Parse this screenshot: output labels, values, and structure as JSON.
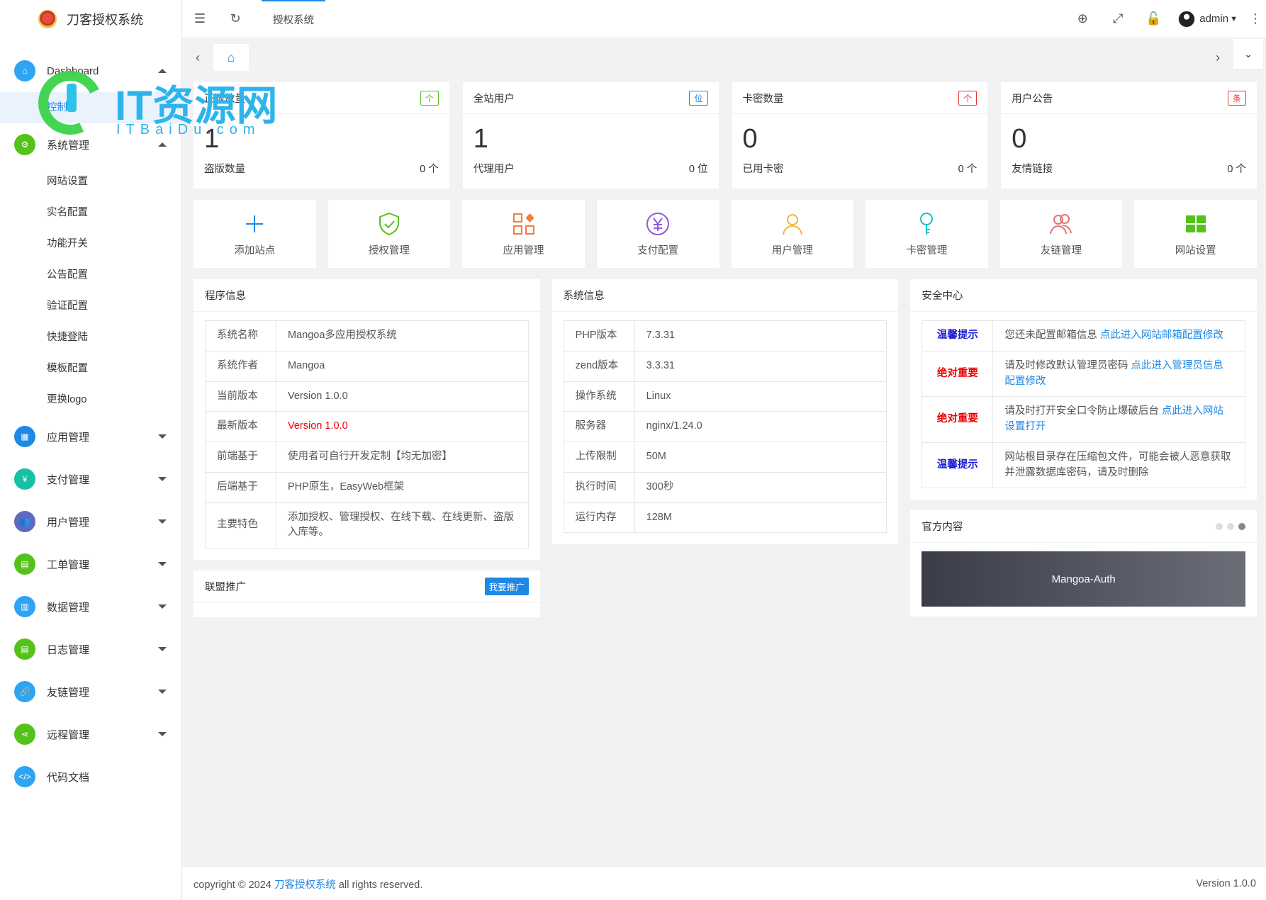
{
  "app": {
    "title": "刀客授权系统"
  },
  "sidebar": {
    "dashboard": {
      "label": "Dashboard",
      "sub": [
        "控制台"
      ]
    },
    "system": {
      "label": "系统管理",
      "sub": [
        "网站设置",
        "实名配置",
        "功能开关",
        "公告配置",
        "验证配置",
        "快捷登陆",
        "模板配置",
        "更换logo"
      ]
    },
    "items": [
      {
        "label": "应用管理",
        "color": "#1e88e5"
      },
      {
        "label": "支付管理",
        "color": "#16c2a6"
      },
      {
        "label": "用户管理",
        "color": "#5c6bc0"
      },
      {
        "label": "工单管理",
        "color": "#55c21b"
      },
      {
        "label": "数据管理",
        "color": "#2ea4f2"
      },
      {
        "label": "日志管理",
        "color": "#55c21b"
      },
      {
        "label": "友链管理",
        "color": "#2ea4f2"
      },
      {
        "label": "远程管理",
        "color": "#55c21b"
      },
      {
        "label": "代码文档",
        "color": "#2ea4f2"
      }
    ]
  },
  "topbar": {
    "tab": "授权系统",
    "user": "admin"
  },
  "stats": [
    {
      "title": "正版数量",
      "badge": "个",
      "badge_color": "#55c21b",
      "value": "1",
      "foot_label": "盗版数量",
      "foot_value": "0 个"
    },
    {
      "title": "全站用户",
      "badge": "位",
      "badge_color": "#1e88e5",
      "value": "1",
      "foot_label": "代理用户",
      "foot_value": "0 位"
    },
    {
      "title": "卡密数量",
      "badge": "个",
      "badge_color": "#e53935",
      "value": "0",
      "foot_label": "已用卡密",
      "foot_value": "0 个"
    },
    {
      "title": "用户公告",
      "badge": "条",
      "badge_color": "#e53935",
      "value": "0",
      "foot_label": "友情链接",
      "foot_value": "0 个"
    }
  ],
  "quick": [
    {
      "label": "添加站点",
      "icon": "plus-icon",
      "color": "#1e88e5"
    },
    {
      "label": "授权管理",
      "icon": "shield-check-icon",
      "color": "#55c21b"
    },
    {
      "label": "应用管理",
      "icon": "apps-icon",
      "color": "#f57c3c"
    },
    {
      "label": "支付配置",
      "icon": "yen-icon",
      "color": "#8e5bd6"
    },
    {
      "label": "用户管理",
      "icon": "user-icon",
      "color": "#f5b43c"
    },
    {
      "label": "卡密管理",
      "icon": "key-icon",
      "color": "#16c2c2"
    },
    {
      "label": "友链管理",
      "icon": "users-icon",
      "color": "#e57373"
    },
    {
      "label": "网站设置",
      "icon": "windows-icon",
      "color": "#55c21b"
    }
  ],
  "program": {
    "title": "程序信息",
    "rows": [
      {
        "k": "系统名称",
        "v": "Mangoa多应用授权系统"
      },
      {
        "k": "系统作者",
        "v": "Mangoa"
      },
      {
        "k": "当前版本",
        "v": "Version 1.0.0"
      },
      {
        "k": "最新版本",
        "v": "Version 1.0.0"
      },
      {
        "k": "前端基于",
        "v": "使用者可自行开发定制【均无加密】"
      },
      {
        "k": "后端基于",
        "v": "PHP原生，EasyWeb框架"
      },
      {
        "k": "主要特色",
        "v": "添加授权、管理授权、在线下载、在线更新、盗版入库等。"
      }
    ]
  },
  "sysinfo": {
    "title": "系统信息",
    "rows": [
      {
        "k": "PHP版本",
        "v": "7.3.31"
      },
      {
        "k": "zend版本",
        "v": "3.3.31"
      },
      {
        "k": "操作系统",
        "v": "Linux"
      },
      {
        "k": "服务器",
        "v": "nginx/1.24.0"
      },
      {
        "k": "上传限制",
        "v": "50M"
      },
      {
        "k": "执行时间",
        "v": "300秒"
      },
      {
        "k": "运行内存",
        "v": "128M"
      }
    ]
  },
  "security": {
    "title": "安全中心",
    "rows": [
      {
        "tag": "温馨提示",
        "text": "您还未配置邮箱信息 ",
        "link": "点此进入网站邮箱配置修改"
      },
      {
        "tag": "绝对重要",
        "text": "请及时修改默认管理员密码 ",
        "link": "点此进入管理员信息配置修改"
      },
      {
        "tag": "绝对重要",
        "text": "请及时打开安全口令防止爆破后台 ",
        "link": "点此进入网站设置打开"
      },
      {
        "tag": "温馨提示",
        "text": "网站根目录存在压缩包文件，可能会被人恶意获取并泄露数据库密码，请及时删除",
        "link": ""
      }
    ]
  },
  "official": {
    "title": "官方内容",
    "banner": "Mangoa-Auth"
  },
  "promo": {
    "title": "联盟推广",
    "button": "我要推广"
  },
  "footer": {
    "prefix": "copyright © 2024 ",
    "link": "刀客授权系统",
    "suffix": " all rights reserved.",
    "version": "Version 1.0.0"
  },
  "watermark": {
    "text": "IT资源网",
    "sub": "ITBaiDu.com"
  }
}
